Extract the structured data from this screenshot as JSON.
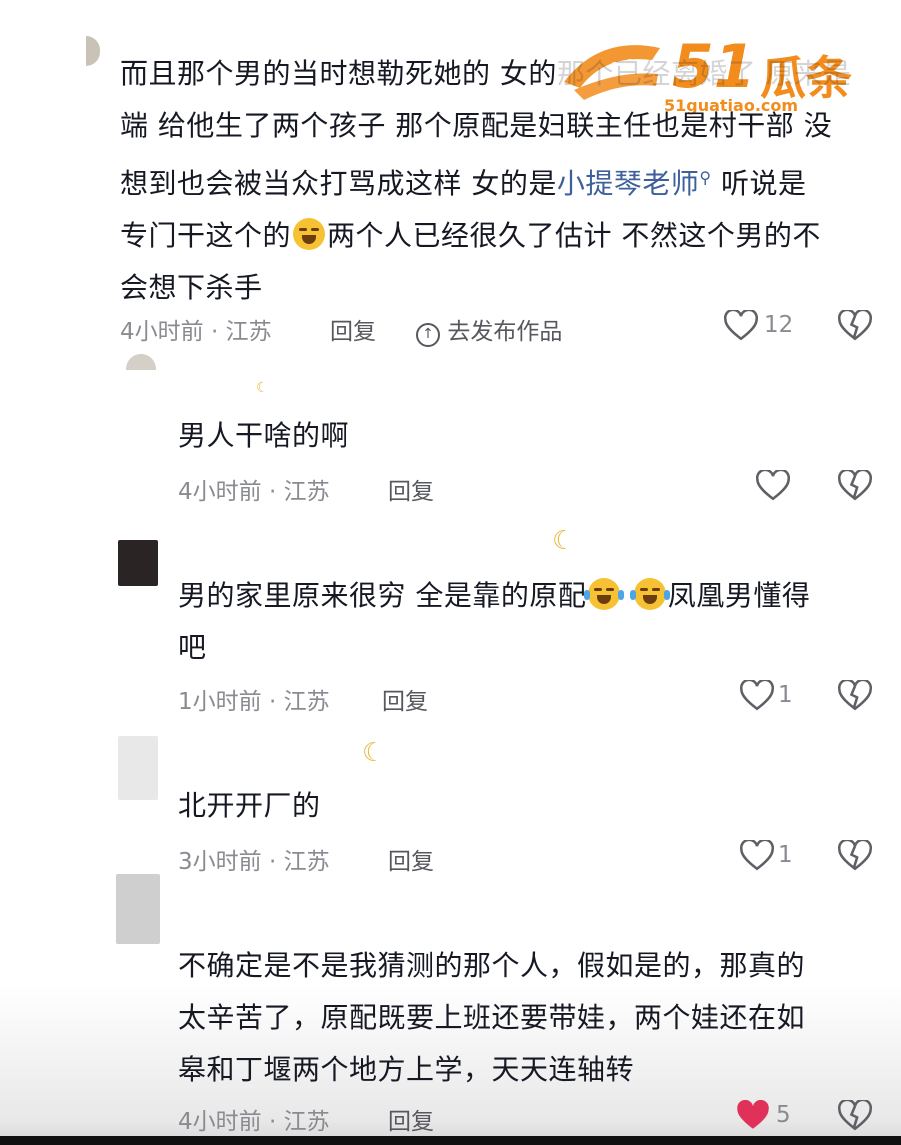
{
  "watermark": {
    "number": "51",
    "text": "瓜条",
    "url": "51guatiao.com"
  },
  "comments": [
    {
      "text_before": "而且那个男的当时想勒死她的 女的",
      "text_hidden": "那个已经离婚了 原来是",
      "text_line2": "端 给他生了两个孩子 那个原配是妇联主任也是村干部 没",
      "text_line3a": "想到也会被当众打骂成这样 女的是",
      "link": "小提琴老师",
      "text_line3b": " 听说是",
      "text_line4a": "专门干这个的",
      "text_line4b": "两个人已经很久了估计 不然这个男的不",
      "text_line5": "会想下杀手",
      "time": "4小时前 · 江苏",
      "reply": "回复",
      "goto": "去发布作品",
      "likes": "12"
    },
    {
      "text": "男人干啥的啊",
      "time": "4小时前 · 江苏",
      "reply": "回复",
      "likes": ""
    },
    {
      "text_a": "男的家里原来很穷 全是靠的原配",
      "text_b": "凤凰男懂得",
      "text_c": "吧",
      "time": "1小时前 · 江苏",
      "reply": "回复",
      "likes": "1"
    },
    {
      "text": "北开开厂的",
      "time": "3小时前 · 江苏",
      "reply": "回复",
      "likes": "1"
    },
    {
      "line1": "不确定是不是我猜测的那个人，假如是的，那真的",
      "line2": "太辛苦了，原配既要上班还要带娃，两个娃还在如",
      "line3": "皋和丁堰两个地方上学，天天连轴转",
      "time": "4小时前 · 江苏",
      "reply": "回复",
      "likes": "5"
    }
  ],
  "colors": {
    "text": "#161823",
    "meta": "#8a8b91",
    "link": "#3d5f9a",
    "liked": "#e0315b",
    "logo": "#f28c1c"
  }
}
